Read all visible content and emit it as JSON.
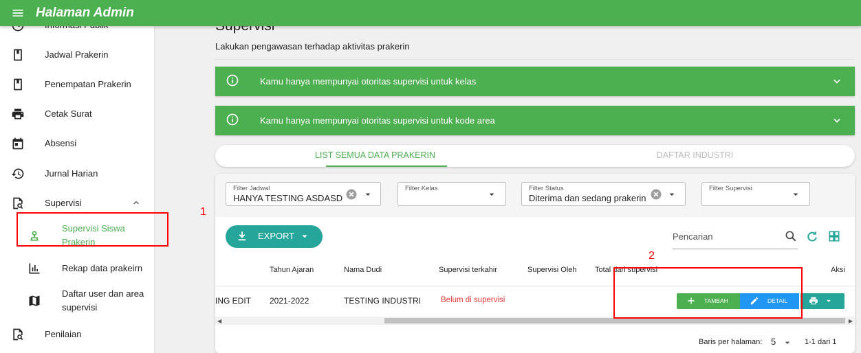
{
  "header": {
    "title": "Halaman Admin"
  },
  "sidebar": {
    "items": [
      {
        "label": "Informasi Publik"
      },
      {
        "label": "Jadwal Prakerin"
      },
      {
        "label": "Penempatan Prakerin"
      },
      {
        "label": "Cetak Surat"
      },
      {
        "label": "Absensi"
      },
      {
        "label": "Jurnal Harian"
      },
      {
        "label": "Supervisi"
      },
      {
        "label": "Supervisi Siswa Prakerin"
      },
      {
        "label": "Rekap data prakeirn"
      },
      {
        "label": "Daftar user dan area supervisi"
      },
      {
        "label": "Penilaian"
      }
    ]
  },
  "page": {
    "title": "Supervisi",
    "subtitle": "Lakukan pengawasan terhadap aktivitas prakerin"
  },
  "banners": [
    {
      "text": "Kamu hanya mempunyai otoritas supervisi untuk kelas"
    },
    {
      "text": "Kamu hanya mempunyai otoritas supervisi untuk kode area"
    }
  ],
  "tabs": [
    {
      "label": "LIST SEMUA DATA PRAKERIN",
      "active": true
    },
    {
      "label": "DAFTAR INDUSTRI",
      "active": false
    }
  ],
  "filters": {
    "jadwal": {
      "label": "Filter Jadwal",
      "value": "HANYA TESTING ASDASD"
    },
    "kelas": {
      "label": "Filter Kelas",
      "value": ""
    },
    "status": {
      "label": "Filter Status",
      "value": "Diterima dan sedang prakerin"
    },
    "supervisi": {
      "label": "Filter Supervisi",
      "value": ""
    }
  },
  "toolbar": {
    "export_label": "EXPORT",
    "search_placeholder": "Pencarian"
  },
  "table": {
    "headers": [
      "Tahun Ajaran",
      "Nama Dudi",
      "Supervisi terkahir",
      "Supervisi Oleh",
      "Total dari supervisi",
      "Aksi"
    ],
    "row": {
      "first_cell": "ING EDIT",
      "tahun": "2021-2022",
      "dudi": "TESTING INDUSTRI",
      "terakhir": "Belum di supervisi"
    },
    "actions": {
      "add": "TAMBAH",
      "detail": "DETAIL"
    }
  },
  "pagination": {
    "rows_label": "Baris per halaman:",
    "rows_value": "5",
    "range": "1-1 dari 1"
  },
  "annotations": {
    "one": "1",
    "two": "2"
  },
  "colors": {
    "primary": "#4caf50",
    "teal": "#26a69a",
    "blue": "#2196f3",
    "danger": "#e53935",
    "annotation": "#ff0000"
  }
}
